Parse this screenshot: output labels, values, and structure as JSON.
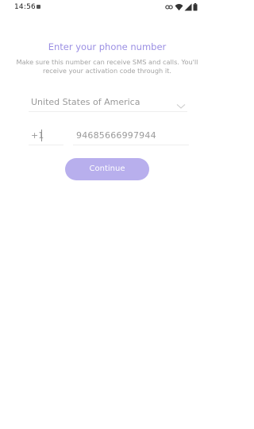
{
  "status_bar": {
    "time": "14:56",
    "icons": [
      "notification-icon",
      "link-icon",
      "wifi-icon",
      "signal-icon",
      "battery-icon"
    ]
  },
  "header": {
    "title": "Enter your phone number",
    "subtitle": "Make sure this number can receive SMS and calls. You'll receive your activation code through it."
  },
  "form": {
    "country": "United States of America",
    "country_code": "+1",
    "phone_number": "94685666997944"
  },
  "actions": {
    "continue_label": "Continue"
  },
  "colors": {
    "accent": "#9b8fe3",
    "button": "#b8afed",
    "muted_text": "#999999"
  }
}
